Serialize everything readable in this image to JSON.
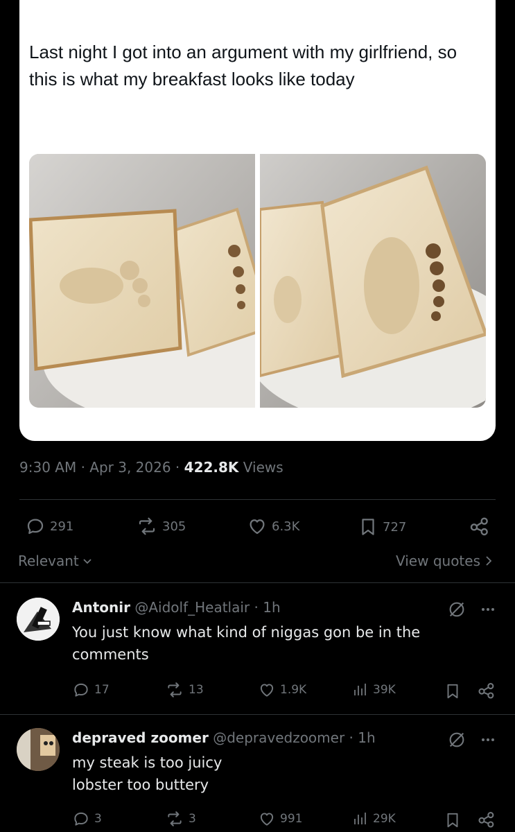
{
  "tweet": {
    "text": "Last night I got into an argument with my girlfriend, so this is what my breakfast looks like today",
    "time": "9:30 AM · Apr 3, 2026 · ",
    "views_count": "422.8K",
    "views_label": " Views"
  },
  "actions": {
    "replies": "291",
    "reposts": "305",
    "likes": "6.3K",
    "bookmarks": "727"
  },
  "filter": {
    "sort_label": "Relevant",
    "quotes_label": "View quotes"
  },
  "replies": [
    {
      "name": "Antonir",
      "handle": "@Aidolf_Heatlair · 1h",
      "text": "You just know what kind of niggas gon be in the comments",
      "replies": "17",
      "reposts": "13",
      "likes": "1.9K",
      "views": "39K"
    },
    {
      "name": "depraved zoomer",
      "handle": "@depravedzoomer · 1h",
      "line1": "my steak is too juicy",
      "line2": "lobster too buttery",
      "replies": "3",
      "reposts": "3",
      "likes": "991",
      "views": "29K"
    }
  ],
  "colors": {
    "background": "#000000",
    "muted": "#71767b",
    "text": "#e7e9ea",
    "divider": "#2f3336"
  },
  "icons": [
    "reply-icon",
    "repost-icon",
    "like-icon",
    "bookmark-icon",
    "share-icon",
    "views-icon",
    "chevron-down-icon",
    "chevron-right-icon",
    "grok-icon",
    "more-icon"
  ]
}
